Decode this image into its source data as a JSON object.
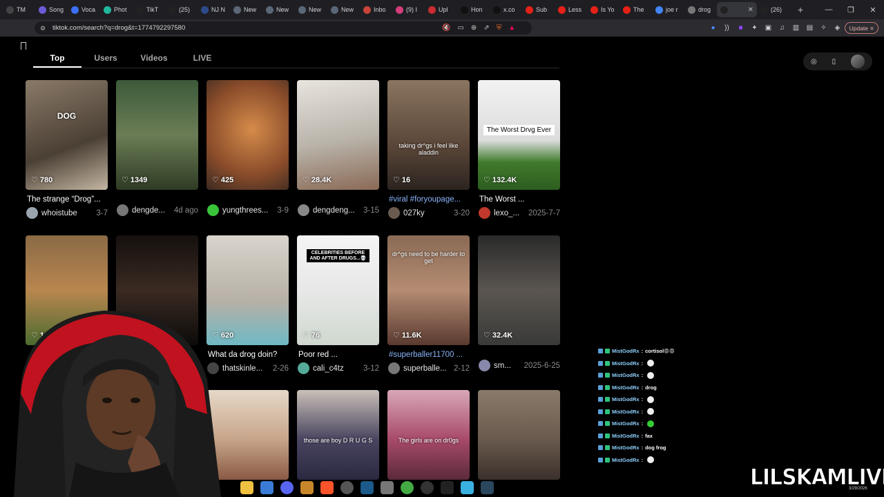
{
  "browser": {
    "tabs": [
      {
        "label": "TM",
        "color": "#444"
      },
      {
        "label": "Song",
        "color": "#6b5bd6"
      },
      {
        "label": "Voca",
        "color": "#3b6ff5"
      },
      {
        "label": "Phot",
        "color": "#1fb89f"
      },
      {
        "label": "TikT",
        "color": "#222"
      },
      {
        "label": "(25)",
        "color": "#222"
      },
      {
        "label": "NJ N",
        "color": "#2e4a8a"
      },
      {
        "label": "New",
        "color": "#5b6777"
      },
      {
        "label": "New",
        "color": "#5b6777"
      },
      {
        "label": "New",
        "color": "#5b6777"
      },
      {
        "label": "New",
        "color": "#5b6777"
      },
      {
        "label": "Inbo",
        "color": "#c9453a"
      },
      {
        "label": "(9) I",
        "color": "#d43d7a"
      },
      {
        "label": "Upl",
        "color": "#c92d2d"
      },
      {
        "label": "Hon",
        "color": "#111"
      },
      {
        "label": "x.co",
        "color": "#111"
      },
      {
        "label": "Sub",
        "color": "#e62117"
      },
      {
        "label": "Less",
        "color": "#e62117"
      },
      {
        "label": "Is Yo",
        "color": "#e62117"
      },
      {
        "label": "The",
        "color": "#e62117"
      },
      {
        "label": "joe r",
        "color": "#4285f4"
      },
      {
        "label": "drog",
        "color": "#777"
      },
      {
        "label": "",
        "color": "#222",
        "active": true
      },
      {
        "label": "(26)",
        "color": "#222"
      }
    ],
    "url": "tiktok.com/search?q=drog&t=1774792297580",
    "update_label": "Update"
  },
  "search_tabs": [
    "Top",
    "Users",
    "Videos",
    "LIVE"
  ],
  "videos": [
    {
      "likes": "780",
      "desc": "The strange “Drog”...",
      "user": "whoistube",
      "date": "3-7",
      "overlay": "DOG",
      "bg": "linear-gradient(160deg,#8a7a68,#4b4035 60%,#c4b6a2)",
      "av": "#9aa4ae"
    },
    {
      "likes": "1349",
      "desc": "",
      "user": "dengde...",
      "date": "4d ago",
      "bg": "linear-gradient(180deg,#3c5a3a,#6b7d55 50%,#2e3b24)",
      "av": "#777"
    },
    {
      "likes": "425",
      "desc": "",
      "user": "yungthrees...",
      "date": "3-9",
      "bg": "radial-gradient(circle at 55% 45%,#d58b4a,#8a4c2a 60%,#3a2a22)",
      "av": "#3ac43a"
    },
    {
      "likes": "28.4K",
      "desc": "",
      "user": "dengdeng...",
      "date": "3-15",
      "bg": "linear-gradient(170deg,#e8e4de,#b9b3aa 55%,#8a6a55)",
      "av": "#888"
    },
    {
      "likes": "16",
      "desc": "#viral #foryoupage...",
      "blue": true,
      "user": "027ky",
      "date": "3-20",
      "overlay": "taking dr^gs i feel like aladdin",
      "bg": "linear-gradient(180deg,#8a7560,#5a4638 60%,#2c2420)",
      "av": "#6b5b4e"
    },
    {
      "likes": "132.4K",
      "desc": "The Worst ...",
      "user": "lexo_...",
      "date": "2025-7-7",
      "box": "The Worst Drvg Ever",
      "bg": "linear-gradient(180deg,#f2f2f2,#dcdcdc 55%,#3f7b2c 75%,#2d5d1f)",
      "av": "#c0392b"
    },
    {
      "likes": "16",
      "desc": "",
      "user": "",
      "date": "",
      "bg": "linear-gradient(180deg,#8a6a45,#b9864f 50%,#4c6b2f)",
      "av": "#666"
    },
    {
      "likes": "",
      "desc": "",
      "user": "",
      "date": "",
      "bg": "linear-gradient(180deg,#15100e,#3a2a22 50%,#0d0b0a)",
      "av": "#555"
    },
    {
      "likes": "620",
      "desc": "What da drog doin?",
      "user": "thatskinle...",
      "date": "2-26",
      "bg": "linear-gradient(180deg,#d9d4cc,#b6b0a6 60%,#6fb9c4)",
      "av": "#444"
    },
    {
      "likes": "76",
      "desc": "Poor red ...",
      "user": "cali_c4tz",
      "date": "3-12",
      "dark": "CELEBRITIES BEFORE AND AFTER DRUGS...💀",
      "bg": "linear-gradient(180deg,#f4f4f4,#e8e8e8 50%,#cfd8cf)",
      "av": "#5a9"
    },
    {
      "likes": "11.6K",
      "desc": "#superballer11700 ...",
      "blue": true,
      "user": "superballe...",
      "date": "2-12",
      "overlay": "dr^gs need to be harder to get",
      "bg": "linear-gradient(180deg,#8a6a55,#b58c73 50%,#5a3a30)",
      "av": "#777"
    },
    {
      "likes": "32.4K",
      "desc": "",
      "user": "sm...",
      "date": "2025-6-25",
      "bg": "linear-gradient(180deg,#2a2a2a,#5a5550 50%,#3a3a38)",
      "av": "#88a"
    },
    {
      "likes": "",
      "desc": "",
      "user": "",
      "date": "",
      "bg": "#000",
      "av": "#000",
      "hidden": true
    },
    {
      "likes": "",
      "desc": "",
      "user": "",
      "date": "",
      "bg": "#000",
      "av": "#000",
      "hidden": true
    },
    {
      "likes": "",
      "desc": "",
      "user": "",
      "date": "",
      "bg": "linear-gradient(180deg,#e6d8c8,#c7a58a 55%,#8a5a44)",
      "av": "#000"
    },
    {
      "likes": "",
      "desc": "",
      "user": "",
      "date": "",
      "overlay": "those are boy D R U G S",
      "bg": "linear-gradient(180deg,#c9c0b8,#4a4560 55%,#2a2840)",
      "av": "#000"
    },
    {
      "likes": "",
      "desc": "",
      "user": "",
      "date": "",
      "overlay": "The girls are on dr0gs",
      "bg": "linear-gradient(180deg,#d8a7b7,#a84a6a 55%,#5a2a3a)",
      "av": "#000"
    },
    {
      "likes": "",
      "desc": "",
      "user": "",
      "date": "",
      "bg": "linear-gradient(180deg,#8a7a6a,#6a5a4e 55%,#3a302a)",
      "av": "#000"
    }
  ],
  "chat": [
    {
      "name": "MistGodRx",
      "msg": "cortisol😡😡"
    },
    {
      "name": "MistGodRx",
      "msg": ""
    },
    {
      "name": "MistGodRx",
      "msg": ""
    },
    {
      "name": "MistGodRx",
      "msg": "drog"
    },
    {
      "name": "MistGodRx",
      "msg": ""
    },
    {
      "name": "MistGodRx",
      "msg": ""
    },
    {
      "name": "MistGodRx",
      "msg": ""
    },
    {
      "name": "MistGodRx",
      "msg": "fax"
    },
    {
      "name": "MistGodRx",
      "msg": "dog frog"
    },
    {
      "name": "MistGodRx",
      "msg": ""
    }
  ],
  "watermark": "LILSKAMLIVE",
  "clock": "3/29/2026"
}
